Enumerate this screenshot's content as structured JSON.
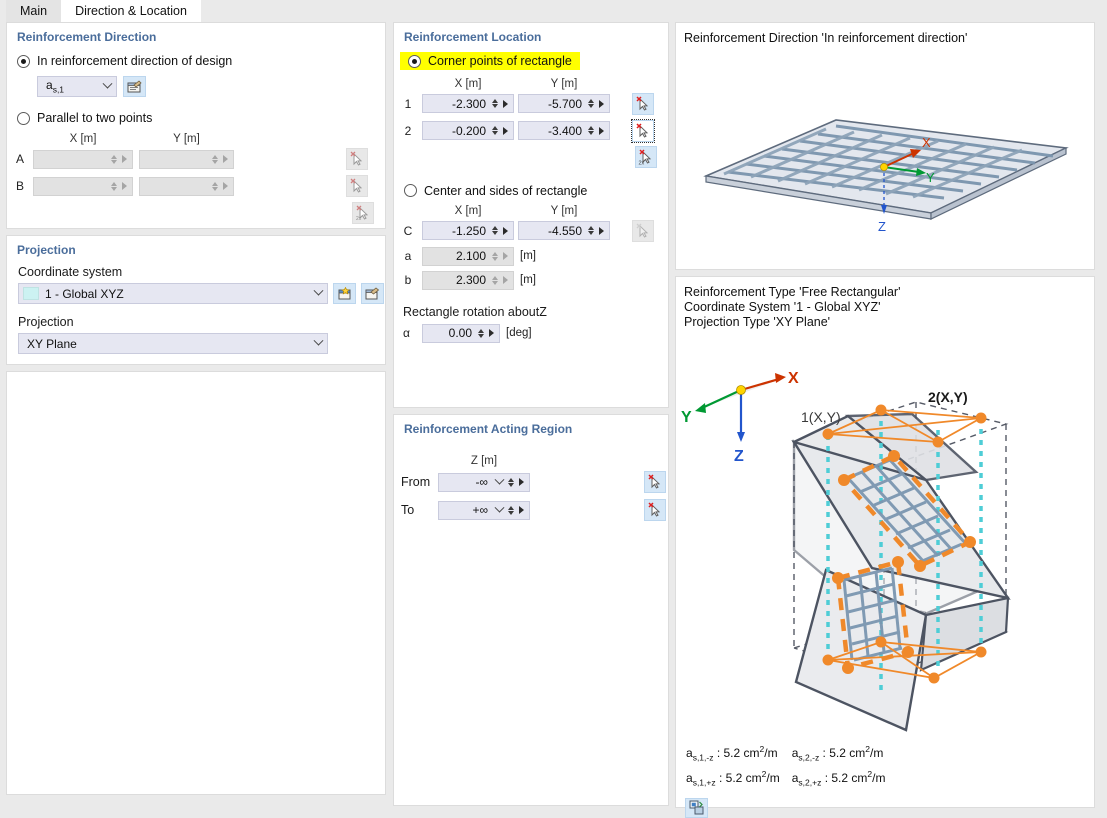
{
  "tabs": [
    {
      "label": "Main",
      "active": false
    },
    {
      "label": "Direction & Location",
      "active": true
    }
  ],
  "reinforcement_direction": {
    "title": "Reinforcement Direction",
    "option_design": {
      "label": "In reinforcement direction of design",
      "selected": true
    },
    "design_select": {
      "value_base": "a",
      "value_sub": "s,1"
    },
    "edit_icon": "edit-properties-icon",
    "option_parallel": {
      "label": "Parallel to two points",
      "selected": false
    },
    "col_x": "X [m]",
    "col_y": "Y [m]",
    "points": [
      {
        "label": "A",
        "x": "",
        "y": "",
        "disabled": true
      },
      {
        "label": "B",
        "x": "",
        "y": "",
        "disabled": true
      }
    ],
    "pick_icons": [
      "pick-point-icon",
      "pick-point-icon",
      "pick-two-points-icon"
    ]
  },
  "projection": {
    "title": "Projection",
    "coordinate_system_label": "Coordinate system",
    "coordinate_system_value": "1 - Global XYZ",
    "new_icon": "new-coordinate-system-icon",
    "edit_icon": "edit-coordinate-system-icon",
    "projection_label": "Projection",
    "projection_value": "XY Plane"
  },
  "reinforcement_location": {
    "title": "Reinforcement Location",
    "option_corner": {
      "label": "Corner points of rectangle",
      "selected": true,
      "highlighted": true
    },
    "col_x": "X [m]",
    "col_y": "Y [m]",
    "corner_points": [
      {
        "label": "1",
        "x": "-2.300",
        "y": "-5.700"
      },
      {
        "label": "2",
        "x": "-0.200",
        "y": "-3.400"
      }
    ],
    "option_center": {
      "label": "Center and sides of rectangle",
      "selected": false
    },
    "center_col_x": "X [m]",
    "center_col_y": "Y [m]",
    "center_row": {
      "label": "C",
      "x": "-1.250",
      "y": "-4.550"
    },
    "side_a": {
      "label": "a",
      "value": "2.100",
      "unit": "[m]"
    },
    "side_b": {
      "label": "b",
      "value": "2.300",
      "unit": "[m]"
    },
    "rotation_label": "Rectangle rotation aboutZ",
    "rotation": {
      "label": "α",
      "value": "0.00",
      "unit": "[deg]"
    },
    "pick_icons": [
      "pick-point-icon",
      "pick-point-icon",
      "pick-two-points-icon",
      "pick-point-icon"
    ]
  },
  "acting_region": {
    "title": "Reinforcement Acting Region",
    "col_z": "Z [m]",
    "from": {
      "label": "From",
      "value": "-∞"
    },
    "to": {
      "label": "To",
      "value": "+∞"
    },
    "pick_icons": [
      "pick-point-icon",
      "pick-point-icon"
    ]
  },
  "view_top": {
    "title": "Reinforcement Direction 'In reinforcement direction'",
    "axes": {
      "x": "X",
      "y": "Y",
      "z": "Z"
    }
  },
  "view_bottom": {
    "line1": "Reinforcement Type 'Free Rectangular'",
    "line2": "Coordinate System '1 - Global XYZ'",
    "line3": "Projection Type 'XY Plane'",
    "axes": {
      "x": "X",
      "y": "Y",
      "z": "Z"
    },
    "point_labels": {
      "p1": "1(X,Y)",
      "p2": "2(X,Y)"
    },
    "legend": [
      {
        "name_base": "a",
        "name_sub": "s,1,-z",
        "sep": ":",
        "value": "5.2 cm",
        "value_sup": "2",
        "value_tail": "/m"
      },
      {
        "name_base": "a",
        "name_sub": "s,2,-z",
        "sep": ":",
        "value": "5.2 cm",
        "value_sup": "2",
        "value_tail": "/m"
      },
      {
        "name_base": "a",
        "name_sub": "s,1,+z",
        "sep": ":",
        "value": "5.2 cm",
        "value_sup": "2",
        "value_tail": "/m"
      },
      {
        "name_base": "a",
        "name_sub": "s,2,+z",
        "sep": ":",
        "value": "5.2 cm",
        "value_sup": "2",
        "value_tail": "/m"
      }
    ],
    "export_icon": "export-image-icon"
  },
  "colors": {
    "accent_title": "#4a6d9b",
    "highlight": "#ffff00",
    "field_bg": "#e6e7f2",
    "field_disabled_bg": "#e2e2e2",
    "pick_button_bg": "#d5e7f7",
    "axis_x": "#cc3300",
    "axis_y": "#009933",
    "axis_z": "#2255cc",
    "rebar_orange": "#f0892a",
    "mesh_blue": "#7a94ad",
    "dashed_cyan": "#4ecdd6"
  }
}
